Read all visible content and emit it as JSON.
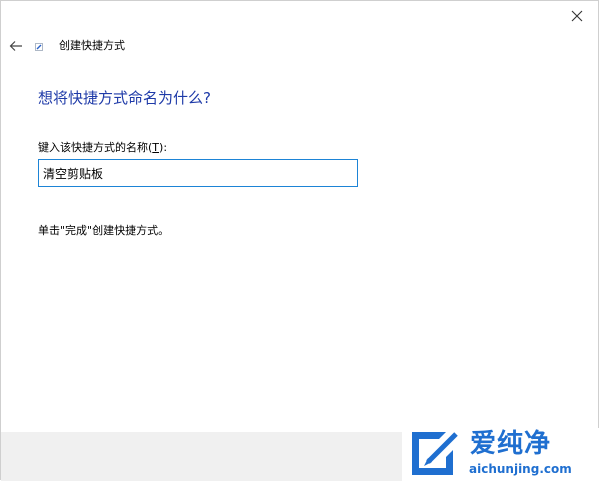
{
  "window": {
    "nav_title": "创建快捷方式"
  },
  "form": {
    "question": "想将快捷方式命名为什么?",
    "label_main": "键入该快捷方式的名称(",
    "label_key": "T",
    "label_end": "):",
    "name_value": "清空剪贴板",
    "hint": "单击\"完成\"创建快捷方式。"
  },
  "watermark": {
    "chinese": "爱纯净",
    "domain": "aichunjing.com"
  },
  "icons": {
    "close": "close-icon",
    "back": "back-arrow-icon",
    "app": "shortcut-app-icon"
  },
  "colors": {
    "accent": "#1e3aa8",
    "input_border": "#1d84d6",
    "footer": "#f0f0f0",
    "watermark": "#1f6fd0"
  }
}
